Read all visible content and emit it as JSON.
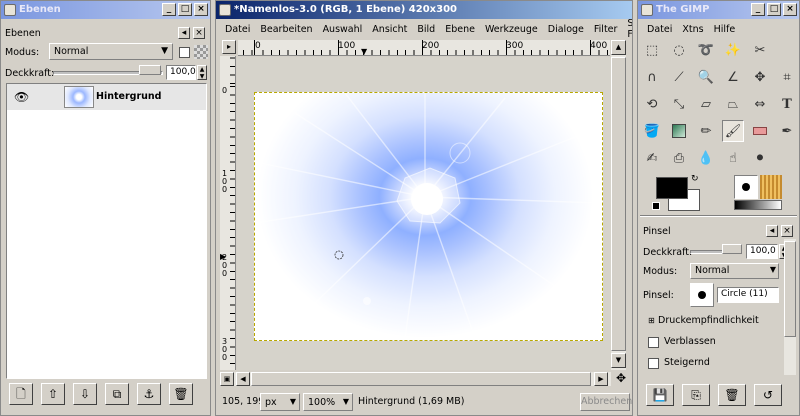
{
  "layers_window": {
    "title": "Ebenen",
    "panel_label": "Ebenen",
    "mode_label": "Modus:",
    "mode_value": "Normal",
    "opacity_label": "Deckkraft:",
    "opacity_value": "100,0",
    "layers": [
      {
        "name": "Hintergrund",
        "visible": true
      }
    ],
    "buttons": [
      "new-layer",
      "raise-layer",
      "lower-layer",
      "duplicate-layer",
      "anchor-layer",
      "delete-layer"
    ]
  },
  "image_window": {
    "title": "*Namenlos-3.0 (RGB, 1 Ebene) 420x300",
    "menu": [
      "Datei",
      "Bearbeiten",
      "Auswahl",
      "Ansicht",
      "Bild",
      "Ebene",
      "Werkzeuge",
      "Dialoge",
      "Filter",
      "Skript-Fu"
    ],
    "ruler_h_labels": [
      "0",
      "100",
      "200",
      "300",
      "400"
    ],
    "ruler_v_labels": [
      "0",
      "1 0 0",
      "2 0 0",
      "3 0 0"
    ],
    "coords": "105, 199",
    "unit": "px",
    "zoom": "100%",
    "status": "Hintergrund (1,69 MB)",
    "cancel_label": "Abbrechen"
  },
  "toolbox_window": {
    "title": "The GIMP",
    "menu": [
      "Datei",
      "Xtns",
      "Hilfe"
    ],
    "tools": [
      "rect-select-icon",
      "ellipse-select-icon",
      "free-select-icon",
      "fuzzy-select-icon",
      "scissors-icon",
      "bezier-path-icon",
      "color-picker-icon",
      "zoom-icon",
      "measure-icon",
      "move-icon",
      "crop-icon",
      "rotate-icon",
      "scale-icon",
      "shear-icon",
      "flip-icon",
      "text-icon",
      "bucket-fill-icon",
      "blend-icon",
      "pencil-icon",
      "paintbrush-icon",
      "eraser-icon",
      "airbrush-icon",
      "clone-icon",
      "blur-icon",
      "smudge-icon",
      "dodge-burn-icon"
    ],
    "brush_panel": {
      "label": "Pinsel",
      "opacity_label": "Deckkraft:",
      "opacity_value": "100,0",
      "mode_label": "Modus:",
      "mode_value": "Normal",
      "brush_label": "Pinsel:",
      "brush_value": "Circle (11)",
      "pressure_label": "Druckempfindlichkeit",
      "fade_label": "Verblassen",
      "incremental_label": "Steigernd"
    },
    "colors": {
      "foreground": "#000000",
      "background": "#ffffff"
    }
  }
}
